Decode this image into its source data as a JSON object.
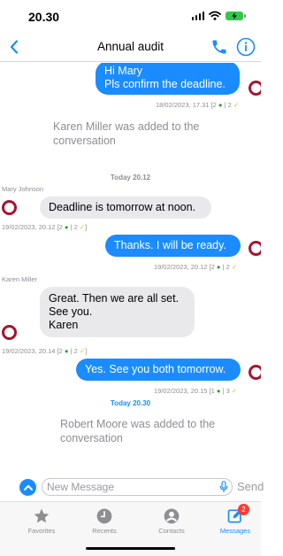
{
  "status_bar": {
    "time": "20.30"
  },
  "header": {
    "title": "Annual audit",
    "back_icon": "chevron-left-icon",
    "call_icon": "phone-icon",
    "info_icon": "info-icon"
  },
  "messages": [
    {
      "direction": "out",
      "text": "Hi Mary\nPls confirm the deadline.",
      "date": "18/02/2023, 17.31",
      "eye_count": "2",
      "check_count": "2"
    },
    {
      "type": "system",
      "text": "Karen Miller was added to the conversation"
    },
    {
      "type": "day",
      "text": "Today 20.12"
    },
    {
      "direction": "in",
      "sender": "Mary Johnson",
      "text": "Deadline is tomorrow at noon.",
      "date": "19/02/2023, 20.12",
      "eye_count": "2",
      "check_count": "2"
    },
    {
      "direction": "out",
      "text": "Thanks. I will be ready.",
      "date": "19/02/2023, 20.12",
      "eye_count": "2",
      "check_count": "2"
    },
    {
      "direction": "in",
      "sender": "Karen Miller",
      "text": "Great. Then we are all set.\nSee you.\nKaren",
      "date": "19/02/2023, 20.14",
      "eye_count": "2",
      "check_count": "2"
    },
    {
      "direction": "out",
      "text": "Yes. See you both tomorrow.",
      "date": "19/02/2023, 20.15",
      "eye_count": "1",
      "check_count": "3"
    },
    {
      "type": "day",
      "text": "Today 20.30"
    },
    {
      "type": "system",
      "text": "Robert Moore was added to the conversation"
    }
  ],
  "input": {
    "placeholder": "New Message",
    "send_label": "Send"
  },
  "tabs": [
    {
      "label": "Favorites",
      "icon": "star-icon"
    },
    {
      "label": "Recents",
      "icon": "clock-icon"
    },
    {
      "label": "Contacts",
      "icon": "person-icon"
    },
    {
      "label": "Messages",
      "icon": "compose-icon",
      "badge": "2",
      "active": true
    }
  ],
  "colors": {
    "accent": "#1a8cff",
    "incoming_bubble": "#e9e9eb",
    "avatar_ring": "#a8142f",
    "badge": "#ff3b30",
    "eye_icon": "#2a9d2a",
    "check_icon": "#f2b50f"
  }
}
